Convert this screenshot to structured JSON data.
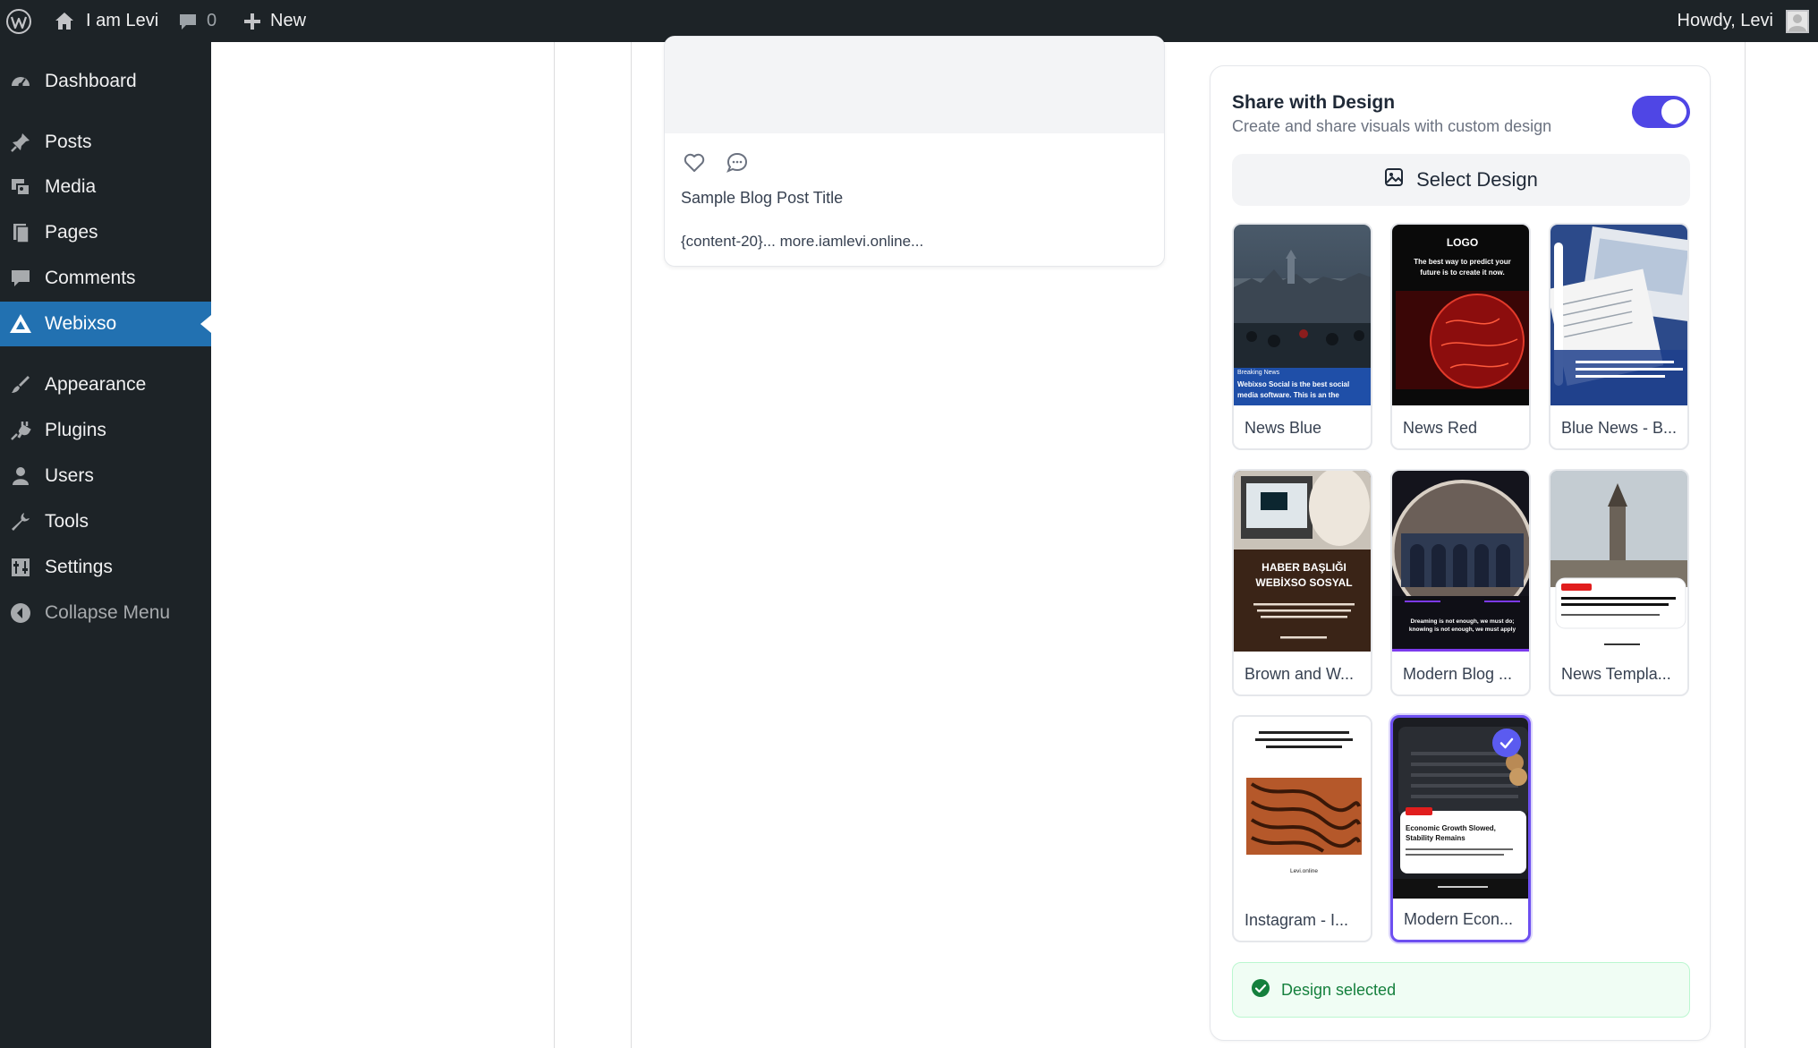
{
  "admin_bar": {
    "site_name": "I am Levi",
    "comments_count": "0",
    "new_label": "New",
    "howdy": "Howdy, Levi"
  },
  "sidebar": {
    "items": [
      {
        "label": "Dashboard",
        "icon": "dashboard-icon"
      },
      {
        "label": "Posts",
        "icon": "pin-icon"
      },
      {
        "label": "Media",
        "icon": "media-icon"
      },
      {
        "label": "Pages",
        "icon": "pages-icon"
      },
      {
        "label": "Comments",
        "icon": "comment-icon"
      },
      {
        "label": "Webixso",
        "icon": "webixso-icon",
        "active": true
      },
      {
        "label": "Appearance",
        "icon": "brush-icon"
      },
      {
        "label": "Plugins",
        "icon": "plug-icon"
      },
      {
        "label": "Users",
        "icon": "user-icon"
      },
      {
        "label": "Tools",
        "icon": "wrench-icon"
      },
      {
        "label": "Settings",
        "icon": "settings-icon"
      },
      {
        "label": "Collapse Menu",
        "icon": "collapse-icon"
      }
    ]
  },
  "preview": {
    "title": "Sample Blog Post Title",
    "excerpt": "{content-20}... more.iamlevi.online..."
  },
  "share": {
    "title": "Share with Design",
    "subtitle": "Create and share visuals with custom design",
    "toggle_on": true,
    "select_button": "Select Design",
    "designs": [
      {
        "name": "News Blue",
        "thumb_text": [
          "Breaking News",
          "Webixso Social is the best social",
          "media software. This is an the"
        ]
      },
      {
        "name": "News Red",
        "thumb_text": [
          "LOGO",
          "The best way to predict your",
          "future is to create it now."
        ]
      },
      {
        "name": "Blue News - B..."
      },
      {
        "name": "Brown and W...",
        "thumb_text": [
          "HABER BAŞLIĞI",
          "WEBİXSO SOSYAL"
        ]
      },
      {
        "name": "Modern Blog ...",
        "thumb_text": [
          "Dreaming is not enough, we must do;",
          "knowing is not enough, we must apply"
        ]
      },
      {
        "name": "News Templa..."
      },
      {
        "name": "Instagram - I...",
        "thumb_text": [
          "Levi.online"
        ]
      },
      {
        "name": "Modern Econ...",
        "selected": true,
        "thumb_text": [
          "Economic Growth Slowed,",
          "Stability Remains"
        ]
      }
    ],
    "status": "Design selected"
  },
  "colors": {
    "admin_bg": "#1d2327",
    "active_menu": "#2271b1",
    "accent": "#4f46e5",
    "success": "#15803d"
  }
}
